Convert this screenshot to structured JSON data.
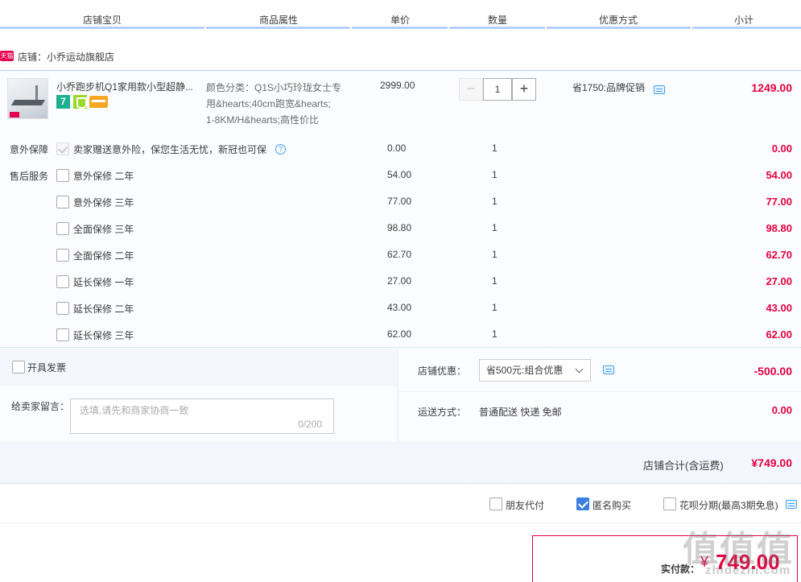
{
  "header": {
    "columns": [
      "店铺宝贝",
      "商品属性",
      "单价",
      "数量",
      "优惠方式",
      "小计"
    ]
  },
  "shop": {
    "badge": "天猫",
    "label": "店铺：小乔运动旗舰店"
  },
  "item": {
    "title": "小乔跑步机Q1家用款小型超静...",
    "badge7": "7",
    "props_lines": [
      "颜色分类：Q1S小巧玲珑女士专",
      "用&hearts;40cm跑宽&hearts;",
      "1-8KM/H&hearts;高性价比"
    ],
    "price": "2999.00",
    "qty_minus": "−",
    "quantity": "1",
    "qty_plus": "+",
    "promo": "省1750:品牌促销",
    "subtotal": "1249.00"
  },
  "services": {
    "accident_label": "意外保障",
    "accident_text": "卖家赠送意外险，保您生活无忧，新冠也可保",
    "accident_help": "?",
    "accident_price": "0.00",
    "accident_qty": "1",
    "accident_subtotal": "0.00",
    "aftersale_label": "售后服务",
    "aftersale": [
      {
        "name": "意外保修 二年",
        "price": "54.00",
        "qty": "1",
        "subtotal": "54.00"
      },
      {
        "name": "意外保修 三年",
        "price": "77.00",
        "qty": "1",
        "subtotal": "77.00"
      },
      {
        "name": "全面保修 三年",
        "price": "98.80",
        "qty": "1",
        "subtotal": "98.80"
      },
      {
        "name": "全面保修 二年",
        "price": "62.70",
        "qty": "1",
        "subtotal": "62.70"
      },
      {
        "name": "延长保修 一年",
        "price": "27.00",
        "qty": "1",
        "subtotal": "27.00"
      },
      {
        "name": "延长保修 二年",
        "price": "43.00",
        "qty": "1",
        "subtotal": "43.00"
      },
      {
        "name": "延长保修 三年",
        "price": "62.00",
        "qty": "1",
        "subtotal": "62.00"
      }
    ]
  },
  "order": {
    "invoice_label": "开具发票",
    "message_label": "给卖家留言：",
    "message_placeholder": "选填,请先和商家协商一致",
    "message_count": "0/200",
    "discount_label": "店铺优惠：",
    "discount_selected": "省500元:组合优惠",
    "discount_value": "-500.00",
    "shipping_label": "运送方式：",
    "shipping_method": "普通配送 快递 免邮",
    "shipping_value": "0.00",
    "shop_total_label": "店铺合计(含运费)",
    "shop_total_value": "¥749.00"
  },
  "options": {
    "friend_pay": "朋友代付",
    "anonymous": "匿名购买",
    "huabei": "花呗分期(最高3期免息)"
  },
  "final": {
    "label": "实付款：",
    "yen": "¥",
    "value": "749.00"
  },
  "watermark": {
    "main": "值值值",
    "sub": "zhidezhi.com"
  },
  "colors": {
    "accent_blue": "#b2d1ff",
    "price_red": "#e3003f",
    "checkbox_blue": "#3c7fe0"
  }
}
